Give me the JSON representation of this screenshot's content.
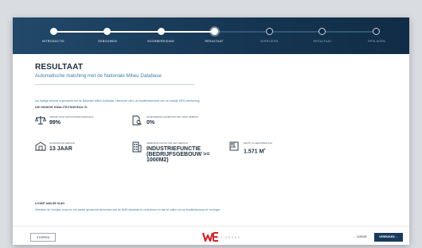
{
  "steps": [
    {
      "label": "INTRODUCTIE",
      "state": "done"
    },
    {
      "label": "GEBOUWEN",
      "state": "done"
    },
    {
      "label": "VOORBEREIDING",
      "state": "done"
    },
    {
      "label": "RESULTAAT",
      "state": "current"
    },
    {
      "label": "VERRIJKEN",
      "state": "pending"
    },
    {
      "label": "RESULTAAT",
      "state": "pending"
    },
    {
      "label": "OPSLAGEN",
      "state": "pending"
    }
  ],
  "page": {
    "title": "RESULTAAT",
    "subtitle": "Automatische matching met de Nationale Milieu Database",
    "intro": "Uw huidige selectie is gematcht met de Nationale Milieu Database. Hieronder ziet u de kwaliteitsniveaus van uw huidige MPG-berekening.",
    "section_label": "UW HUIDIGE KWALITEITSNIVEAU IS:"
  },
  "stats": {
    "matched_pct_label": "PERCENTAGE GEMATCHEDE ENERGIE(S)",
    "matched_pct_value": "99%",
    "unmatched_label": "GENEGEERDE ELEMENTEN MET GEEN GEBRUIK",
    "unmatched_value": "0%",
    "lifespan_label": "LEVENSDUUR GEBOUW",
    "lifespan_value": "13 JAAR",
    "function_label": "GEBRUIKSFUNCTIE VAN HET GEBOUW",
    "function_value": "INDUSTRIEFUNCTIE (BEDRIJFSGEBOUW >= 1000M2)",
    "area_label": "BRUTO VLOEROPPERVLAK",
    "area_value": "1.571 M",
    "area_unit_sup": "2"
  },
  "choice": {
    "label": "U KUNT AAN DE SLAG",
    "text": "Selecteer de Verrijken knop om het aantal gematchte elementen met de NMD database te controleren en aan te vullen om uw kwaliteitsniveau te verhogen."
  },
  "footer": {
    "stop_label": "STOPPEN",
    "logo_text": "ADVISEURS",
    "back_label": "VORIGE",
    "next_label": "VERRIJKEN"
  },
  "colors": {
    "header": "#153552",
    "step_done": "#ffffff",
    "step_pending": "#0f2a44",
    "accent": "#3d7fa9",
    "logo_red": "#d7262e"
  },
  "icons": {
    "matched": "scale-icon",
    "unmatched": "document-search-icon",
    "lifespan": "building-icon",
    "function": "office-building-icon",
    "area": "floorplan-icon",
    "next": "arrow-right-icon",
    "back": "arrow-left-icon"
  }
}
